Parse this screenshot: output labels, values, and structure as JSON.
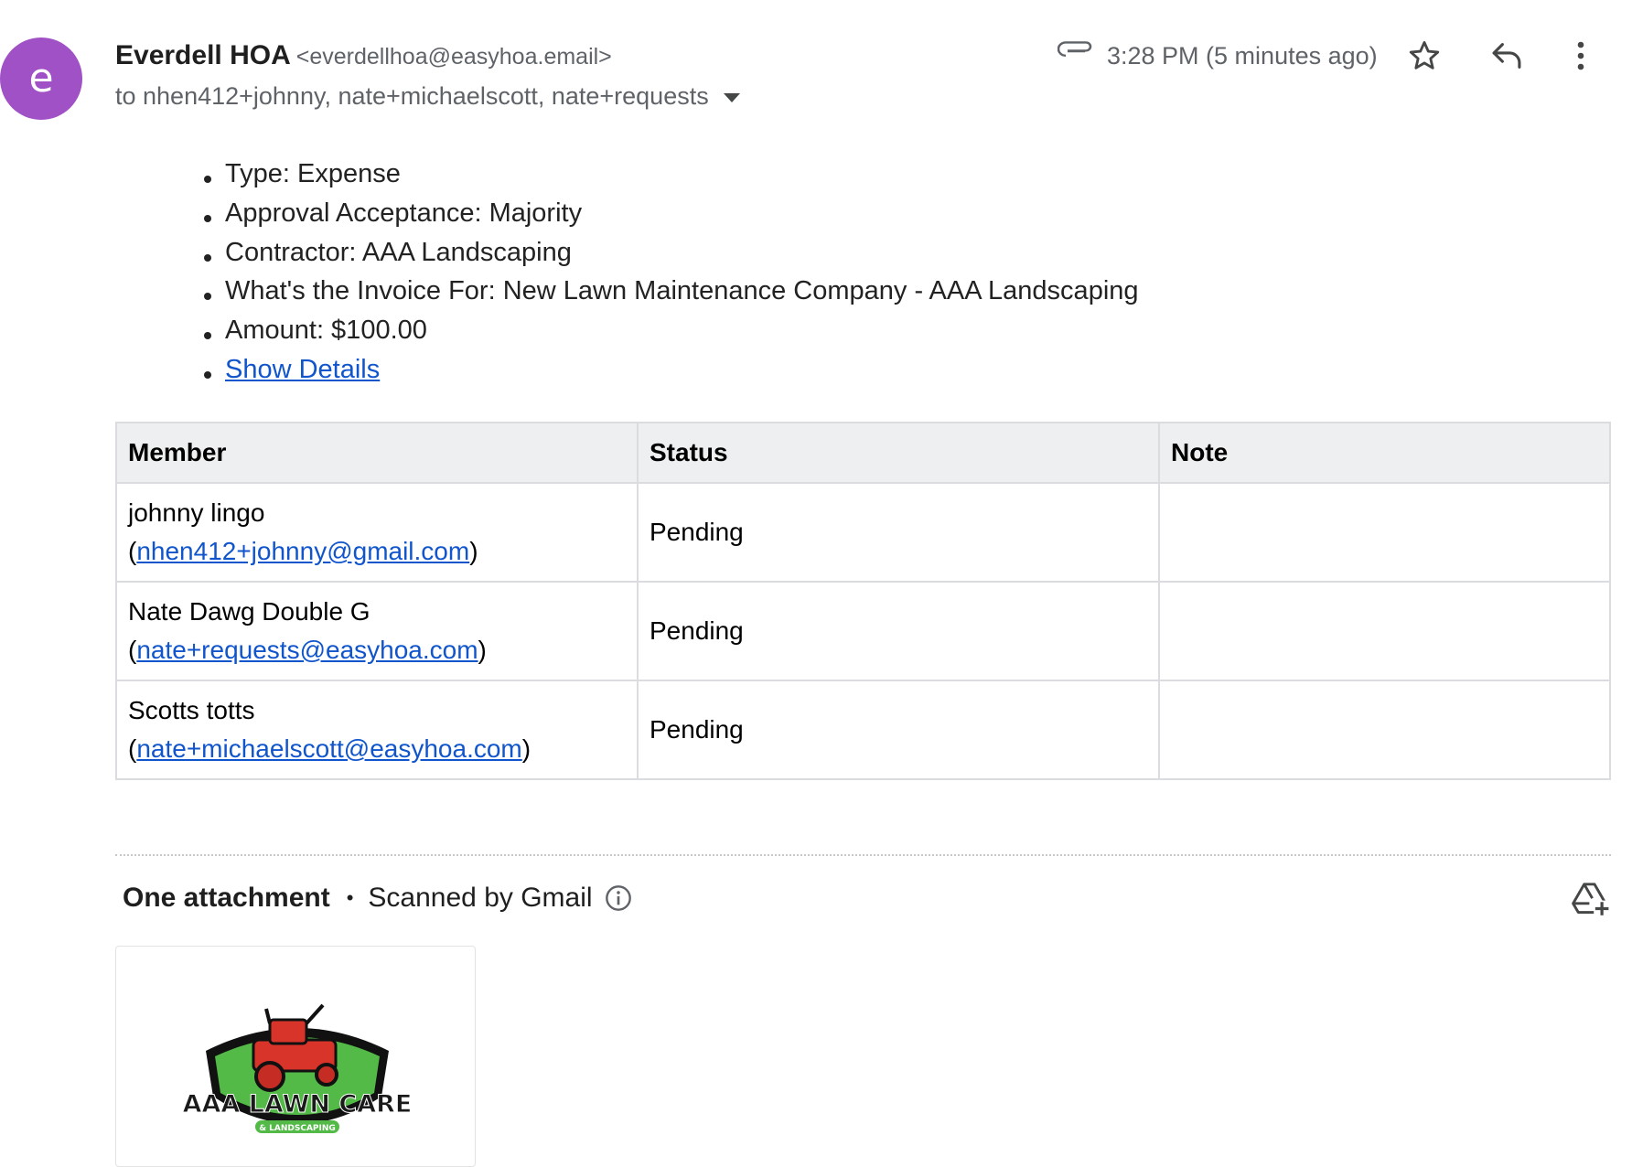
{
  "avatar": {
    "letter": "e",
    "color": "#a051c6"
  },
  "sender": {
    "name": "Everdell HOA",
    "email": "<everdellhoa@easyhoa.email>",
    "to": "to nhen412+johnny, nate+michaelscott, nate+requests"
  },
  "header": {
    "time": "3:28 PM (5 minutes ago)",
    "icons": [
      "paperclip-icon",
      "star-icon",
      "reply-icon",
      "more-vert-icon"
    ]
  },
  "details": {
    "items": [
      "Type: Expense",
      "Approval Acceptance: Majority",
      "Contractor: AAA Landscaping",
      "What's the Invoice For: New Lawn Maintenance Company - AAA Landscaping",
      "Amount: $100.00"
    ],
    "show_details": "Show Details"
  },
  "table": {
    "headers": [
      "Member",
      "Status",
      "Note"
    ],
    "rows": [
      {
        "name": "johnny lingo",
        "email": "nhen412+johnny@gmail.com",
        "status": "Pending",
        "note": ""
      },
      {
        "name": "Nate Dawg Double G",
        "email": "nate+requests@easyhoa.com",
        "status": "Pending",
        "note": ""
      },
      {
        "name": "Scotts totts",
        "email": "nate+michaelscott@easyhoa.com",
        "status": "Pending",
        "note": ""
      }
    ]
  },
  "attachments": {
    "title": "One attachment",
    "separator": "•",
    "scanned": "Scanned by Gmail",
    "file_logo_text": "AAA LAWN CARE",
    "file_logo_subtext": "& LANDSCAPING"
  },
  "colors": {
    "link": "#1155cc",
    "header_bg": "#eeeff1",
    "border": "#dadce0"
  }
}
